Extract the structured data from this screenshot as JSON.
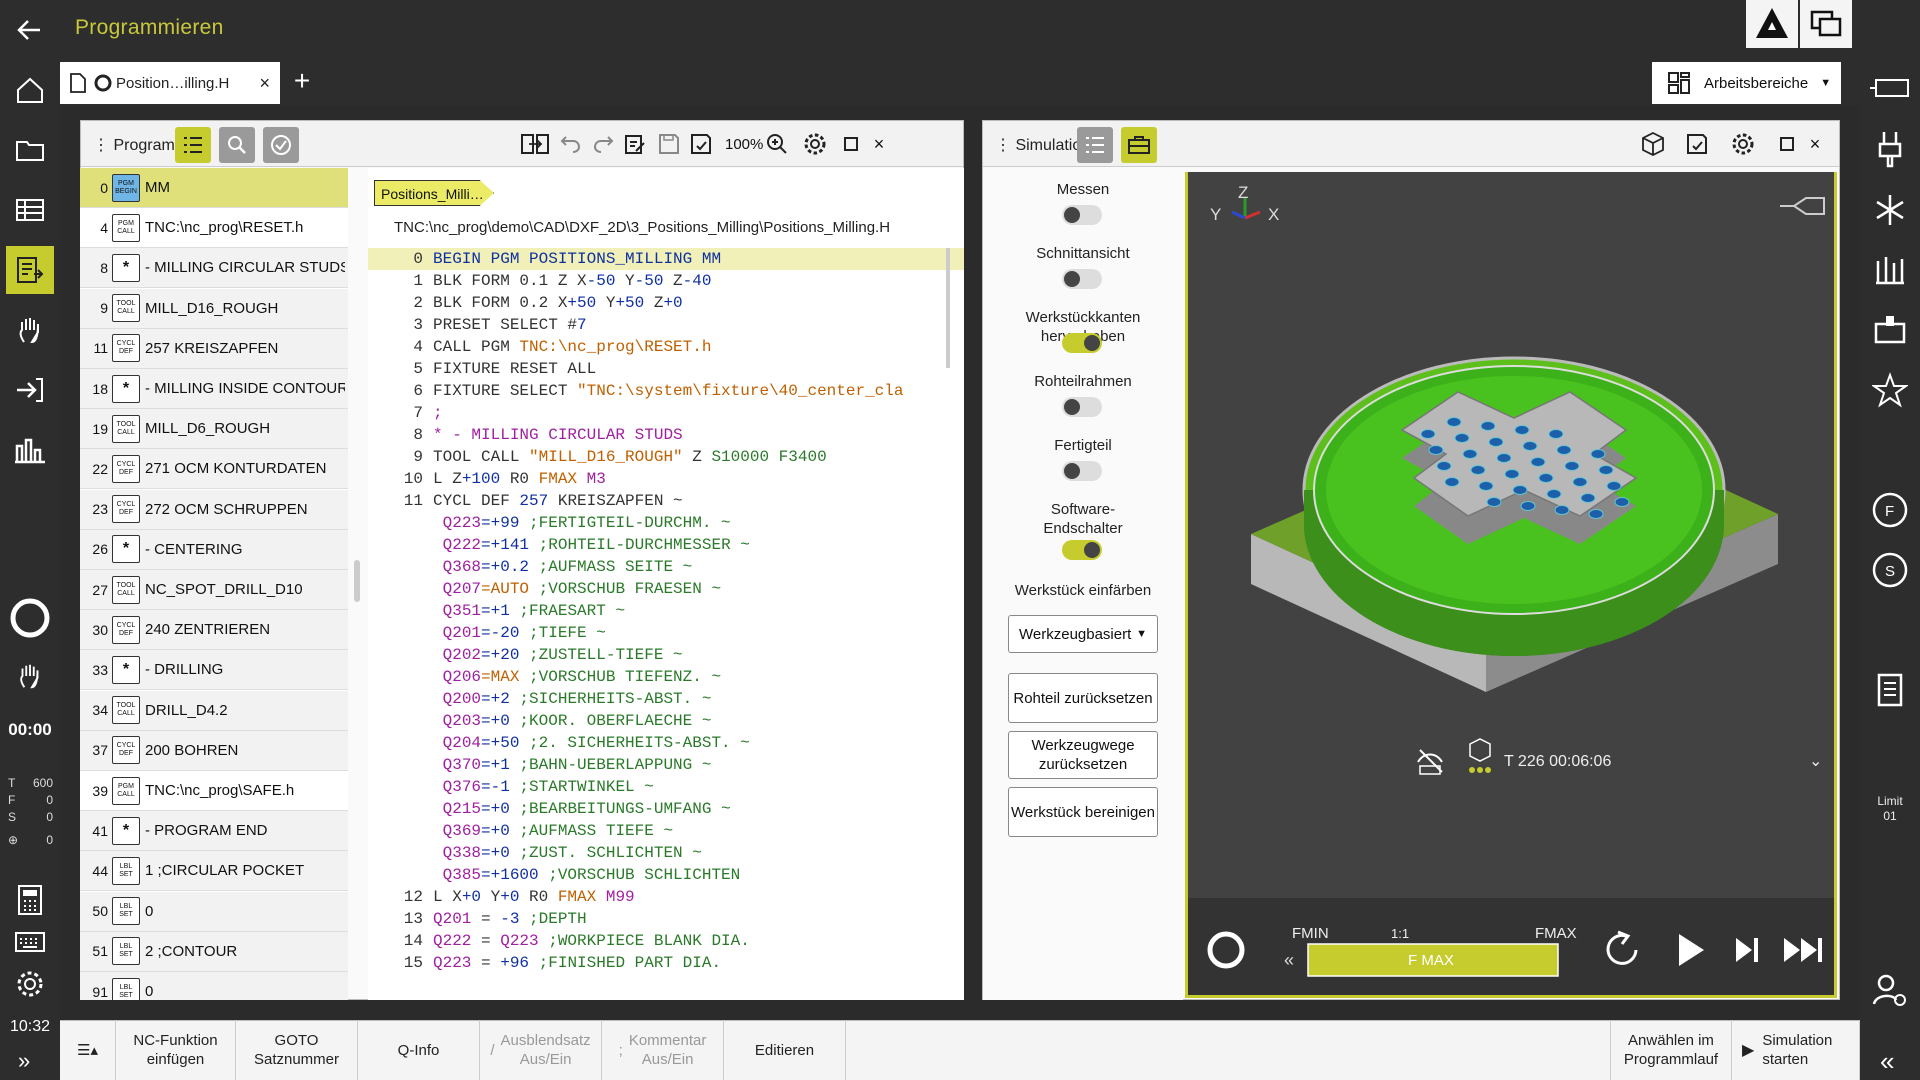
{
  "app": {
    "title": "Programmieren"
  },
  "tab": {
    "label": "Position…illing.H",
    "close": "×",
    "add": "+"
  },
  "workspaces": {
    "label": "Arbeitsbereiche"
  },
  "program_panel": {
    "title": "Programm",
    "zoom": "100%",
    "breadcrumb": "Positions_Milli…",
    "path": "TNC:\\nc_prog\\demo\\CAD\\DXF_2D\\3_Positions_Milling\\Positions_Milling.H",
    "structure": [
      {
        "num": "0",
        "badge": [
          "PGM",
          "BEGIN"
        ],
        "label": "MM",
        "sel": true
      },
      {
        "num": "4",
        "badge": [
          "PGM",
          "CALL"
        ],
        "label": "TNC:\\nc_prog\\RESET.h",
        "white": true
      },
      {
        "num": "8",
        "badge": [
          "*"
        ],
        "label": "- MILLING CIRCULAR STUDS"
      },
      {
        "num": "9",
        "badge": [
          "TOOL",
          "CALL"
        ],
        "label": "MILL_D16_ROUGH"
      },
      {
        "num": "11",
        "badge": [
          "CYCL",
          "DEF"
        ],
        "label": "257 KREISZAPFEN"
      },
      {
        "num": "18",
        "badge": [
          "*"
        ],
        "label": "- MILLING INSIDE CONTOUR"
      },
      {
        "num": "19",
        "badge": [
          "TOOL",
          "CALL"
        ],
        "label": "MILL_D6_ROUGH"
      },
      {
        "num": "22",
        "badge": [
          "CYCL",
          "DEF"
        ],
        "label": "271 OCM KONTURDATEN"
      },
      {
        "num": "23",
        "badge": [
          "CYCL",
          "DEF"
        ],
        "label": "272 OCM SCHRUPPEN"
      },
      {
        "num": "26",
        "badge": [
          "*"
        ],
        "label": "- CENTERING"
      },
      {
        "num": "27",
        "badge": [
          "TOOL",
          "CALL"
        ],
        "label": "NC_SPOT_DRILL_D10"
      },
      {
        "num": "30",
        "badge": [
          "CYCL",
          "DEF"
        ],
        "label": "240 ZENTRIEREN"
      },
      {
        "num": "33",
        "badge": [
          "*"
        ],
        "label": "- DRILLING"
      },
      {
        "num": "34",
        "badge": [
          "TOOL",
          "CALL"
        ],
        "label": "DRILL_D4.2"
      },
      {
        "num": "37",
        "badge": [
          "CYCL",
          "DEF"
        ],
        "label": "200 BOHREN"
      },
      {
        "num": "39",
        "badge": [
          "PGM",
          "CALL"
        ],
        "label": "TNC:\\nc_prog\\SAFE.h",
        "white": true
      },
      {
        "num": "41",
        "badge": [
          "*"
        ],
        "label": "- PROGRAM END"
      },
      {
        "num": "44",
        "badge": [
          "LBL",
          "SET"
        ],
        "label": "1   ;CIRCULAR POCKET"
      },
      {
        "num": "50",
        "badge": [
          "LBL",
          "SET"
        ],
        "label": "0"
      },
      {
        "num": "51",
        "badge": [
          "LBL",
          "SET"
        ],
        "label": "2   ;CONTOUR"
      },
      {
        "num": "91",
        "badge": [
          "LBL",
          "SET"
        ],
        "label": "0"
      }
    ],
    "code": [
      {
        "n": "0",
        "hl": true,
        "parts": [
          [
            "k",
            "BEGIN PGM POSITIONS_MILLING MM"
          ]
        ]
      },
      {
        "n": "1",
        "parts": [
          [
            "b",
            "BLK FORM 0.1 Z X"
          ],
          [
            "k",
            "-50"
          ],
          [
            "b",
            " Y"
          ],
          [
            "k",
            "-50"
          ],
          [
            "b",
            " Z"
          ],
          [
            "k",
            "-40"
          ]
        ]
      },
      {
        "n": "2",
        "parts": [
          [
            "b",
            "BLK FORM 0.2 X"
          ],
          [
            "k",
            "+50"
          ],
          [
            "b",
            " Y"
          ],
          [
            "k",
            "+50"
          ],
          [
            "b",
            " Z"
          ],
          [
            "k",
            "+0"
          ]
        ]
      },
      {
        "n": "3",
        "parts": [
          [
            "b",
            "PRESET SELECT #"
          ],
          [
            "k",
            "7"
          ]
        ]
      },
      {
        "n": "4",
        "parts": [
          [
            "b",
            "CALL PGM "
          ],
          [
            "o",
            "TNC:\\nc_prog\\RESET.h"
          ]
        ]
      },
      {
        "n": "5",
        "parts": [
          [
            "b",
            "FIXTURE RESET ALL"
          ]
        ]
      },
      {
        "n": "6",
        "parts": [
          [
            "b",
            "FIXTURE SELECT "
          ],
          [
            "o",
            "\"TNC:\\system\\fixture\\40_center_cla"
          ]
        ]
      },
      {
        "n": "7",
        "parts": [
          [
            "p",
            ";"
          ]
        ]
      },
      {
        "n": "8",
        "parts": [
          [
            "p",
            "* - MILLING CIRCULAR STUDS"
          ]
        ]
      },
      {
        "n": "9",
        "parts": [
          [
            "b",
            "TOOL CALL "
          ],
          [
            "o",
            "\"MILL_D16_ROUGH\""
          ],
          [
            "b",
            " Z "
          ],
          [
            "g",
            "S10000 F3400"
          ]
        ]
      },
      {
        "n": "10",
        "parts": [
          [
            "b",
            "L Z"
          ],
          [
            "k",
            "+100"
          ],
          [
            "b",
            " R0 "
          ],
          [
            "o",
            "FMAX"
          ],
          [
            "b",
            " "
          ],
          [
            "p",
            "M3"
          ]
        ]
      },
      {
        "n": "11",
        "parts": [
          [
            "b",
            "CYCL DEF "
          ],
          [
            "k",
            "257"
          ],
          [
            "b",
            " KREISZAPFEN ~"
          ]
        ]
      },
      {
        "n": "",
        "parts": [
          [
            "b",
            " "
          ],
          [
            "p",
            "Q223"
          ],
          [
            "k",
            "=+99"
          ],
          [
            "g",
            " ;FERTIGTEIL-DURCHM. ~"
          ]
        ]
      },
      {
        "n": "",
        "parts": [
          [
            "b",
            " "
          ],
          [
            "p",
            "Q222"
          ],
          [
            "k",
            "=+141"
          ],
          [
            "g",
            " ;ROHTEIL-DURCHMESSER ~"
          ]
        ]
      },
      {
        "n": "",
        "parts": [
          [
            "b",
            " "
          ],
          [
            "p",
            "Q368"
          ],
          [
            "k",
            "=+0.2"
          ],
          [
            "g",
            " ;AUFMASS SEITE ~"
          ]
        ]
      },
      {
        "n": "",
        "parts": [
          [
            "b",
            " "
          ],
          [
            "p",
            "Q207"
          ],
          [
            "o",
            "=AUTO"
          ],
          [
            "g",
            " ;VORSCHUB FRAESEN ~"
          ]
        ]
      },
      {
        "n": "",
        "parts": [
          [
            "b",
            " "
          ],
          [
            "p",
            "Q351"
          ],
          [
            "k",
            "=+1"
          ],
          [
            "g",
            " ;FRAESART ~"
          ]
        ]
      },
      {
        "n": "",
        "parts": [
          [
            "b",
            " "
          ],
          [
            "p",
            "Q201"
          ],
          [
            "k",
            "=-20"
          ],
          [
            "g",
            " ;TIEFE ~"
          ]
        ]
      },
      {
        "n": "",
        "parts": [
          [
            "b",
            " "
          ],
          [
            "p",
            "Q202"
          ],
          [
            "k",
            "=+20"
          ],
          [
            "g",
            " ;ZUSTELL-TIEFE ~"
          ]
        ]
      },
      {
        "n": "",
        "parts": [
          [
            "b",
            " "
          ],
          [
            "p",
            "Q206"
          ],
          [
            "o",
            "=MAX"
          ],
          [
            "g",
            " ;VORSCHUB TIEFENZ. ~"
          ]
        ]
      },
      {
        "n": "",
        "parts": [
          [
            "b",
            " "
          ],
          [
            "p",
            "Q200"
          ],
          [
            "k",
            "=+2"
          ],
          [
            "g",
            " ;SICHERHEITS-ABST. ~"
          ]
        ]
      },
      {
        "n": "",
        "parts": [
          [
            "b",
            " "
          ],
          [
            "p",
            "Q203"
          ],
          [
            "k",
            "=+0"
          ],
          [
            "g",
            " ;KOOR. OBERFLAECHE ~"
          ]
        ]
      },
      {
        "n": "",
        "parts": [
          [
            "b",
            " "
          ],
          [
            "p",
            "Q204"
          ],
          [
            "k",
            "=+50"
          ],
          [
            "g",
            " ;2. SICHERHEITS-ABST. ~"
          ]
        ]
      },
      {
        "n": "",
        "parts": [
          [
            "b",
            " "
          ],
          [
            "p",
            "Q370"
          ],
          [
            "k",
            "=+1"
          ],
          [
            "g",
            " ;BAHN-UEBERLAPPUNG ~"
          ]
        ]
      },
      {
        "n": "",
        "parts": [
          [
            "b",
            " "
          ],
          [
            "p",
            "Q376"
          ],
          [
            "k",
            "=-1"
          ],
          [
            "g",
            " ;STARTWINKEL ~"
          ]
        ]
      },
      {
        "n": "",
        "parts": [
          [
            "b",
            " "
          ],
          [
            "p",
            "Q215"
          ],
          [
            "k",
            "=+0"
          ],
          [
            "g",
            " ;BEARBEITUNGS-UMFANG ~"
          ]
        ]
      },
      {
        "n": "",
        "parts": [
          [
            "b",
            " "
          ],
          [
            "p",
            "Q369"
          ],
          [
            "k",
            "=+0"
          ],
          [
            "g",
            " ;AUFMASS TIEFE ~"
          ]
        ]
      },
      {
        "n": "",
        "parts": [
          [
            "b",
            " "
          ],
          [
            "p",
            "Q338"
          ],
          [
            "k",
            "=+0"
          ],
          [
            "g",
            " ;ZUST. SCHLICHTEN ~"
          ]
        ]
      },
      {
        "n": "",
        "parts": [
          [
            "b",
            " "
          ],
          [
            "p",
            "Q385"
          ],
          [
            "k",
            "=+1600"
          ],
          [
            "g",
            " ;VORSCHUB SCHLICHTEN"
          ]
        ]
      },
      {
        "n": "12",
        "parts": [
          [
            "b",
            "L X"
          ],
          [
            "k",
            "+0"
          ],
          [
            "b",
            " Y"
          ],
          [
            "k",
            "+0"
          ],
          [
            "b",
            " R0 "
          ],
          [
            "o",
            "FMAX"
          ],
          [
            "b",
            " "
          ],
          [
            "p",
            "M99"
          ]
        ]
      },
      {
        "n": "13",
        "parts": [
          [
            "p",
            "Q201"
          ],
          [
            "b",
            " = "
          ],
          [
            "k",
            "-3"
          ],
          [
            "g",
            " ;DEPTH"
          ]
        ]
      },
      {
        "n": "14",
        "parts": [
          [
            "p",
            "Q222"
          ],
          [
            "b",
            " = "
          ],
          [
            "p",
            "Q223"
          ],
          [
            "g",
            " ;WORKPIECE BLANK DIA."
          ]
        ]
      },
      {
        "n": "15",
        "parts": [
          [
            "p",
            "Q223"
          ],
          [
            "b",
            " = "
          ],
          [
            "k",
            "+96"
          ],
          [
            "g",
            " ;FINISHED PART DIA."
          ]
        ]
      }
    ]
  },
  "simulation": {
    "title": "Simulation",
    "options": [
      {
        "label": "Messen",
        "on": false
      },
      {
        "label": "Schnittansicht",
        "on": false
      },
      {
        "label": "Werkstückkanten hervorheben",
        "on": true
      },
      {
        "label": "Rohteilrahmen",
        "on": false
      },
      {
        "label": "Fertigteil",
        "on": false
      },
      {
        "label": "Software-\nEndschalter",
        "on": true
      }
    ],
    "color_label": "Werkstück einfärben",
    "color_value": "Werkzeugbasiert",
    "buttons": [
      "Rohteil zurücksetzen",
      "Werkzeugwege\nzurücksetzen",
      "Werkstück bereinigen"
    ],
    "axis": {
      "z": "Z",
      "y": "Y",
      "x": "X"
    },
    "tool_info": "T 226  00:06:06",
    "feed": {
      "fmin": "FMIN",
      "ratio": "1:1",
      "fmax": "FMAX",
      "bar": "F MAX"
    }
  },
  "left_status": {
    "time": "00:00",
    "t": "T",
    "t_val": "600",
    "f": "F",
    "f_val": "0",
    "s": "S",
    "s_val": "0",
    "extra_val": "0",
    "clock": "10:32"
  },
  "right_status": {
    "limit": "Limit",
    "limit_val": "01"
  },
  "bottom": {
    "nc_func": "NC-Funktion\neinfügen",
    "goto": "GOTO\nSatznummer",
    "qinfo": "Q-Info",
    "hide": "Ausblendsatz\nAus/Ein",
    "comment": "Kommentar\nAus/Ein",
    "edit": "Editieren",
    "select": "Anwählen im\nProgrammlauf",
    "sim_start": "Simulation\nstarten"
  },
  "colors": {
    "accent": "#c6cc2e",
    "dark": "#2d2d2d"
  }
}
